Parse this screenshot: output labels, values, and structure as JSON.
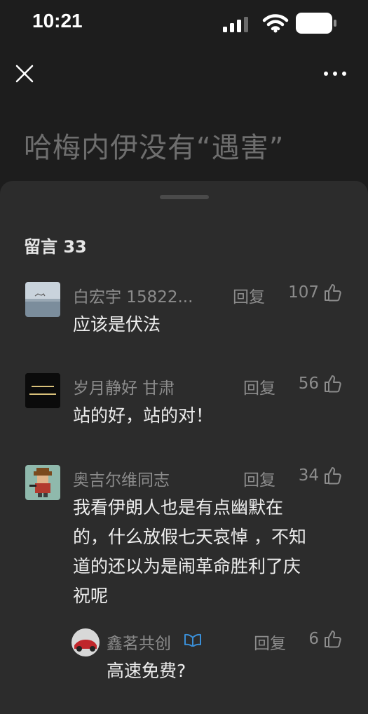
{
  "status_bar": {
    "time": "10:21"
  },
  "article": {
    "title": "哈梅内伊没有“遇害”"
  },
  "comments_panel": {
    "header": "留言 33",
    "comments": [
      {
        "author": "白宏宇 15822...",
        "reply_label": "回复",
        "likes": "107",
        "text": "应该是伏法"
      },
      {
        "author": "岁月静好  甘肃",
        "reply_label": "回复",
        "likes": "56",
        "text": "站的好，站的对！"
      },
      {
        "author": "奥吉尔维同志",
        "reply_label": "回复",
        "likes": "34",
        "text_lines": [
          "我看伊朗人也是有点幽默在",
          "的，什么放假七天哀悼 ，不知",
          "道的还以为是闹革命胜利了庆",
          "祝呢"
        ]
      },
      {
        "author": "鑫茗共创",
        "reply_label": "回复",
        "likes": "6",
        "text": "高速免费?",
        "is_reply": true
      }
    ]
  },
  "colors": {
    "background": "#1d1d1d",
    "sheet": "#2c2c2c",
    "muted_text": "#8c8c8c",
    "verified_badge": "#3a8fd8"
  }
}
